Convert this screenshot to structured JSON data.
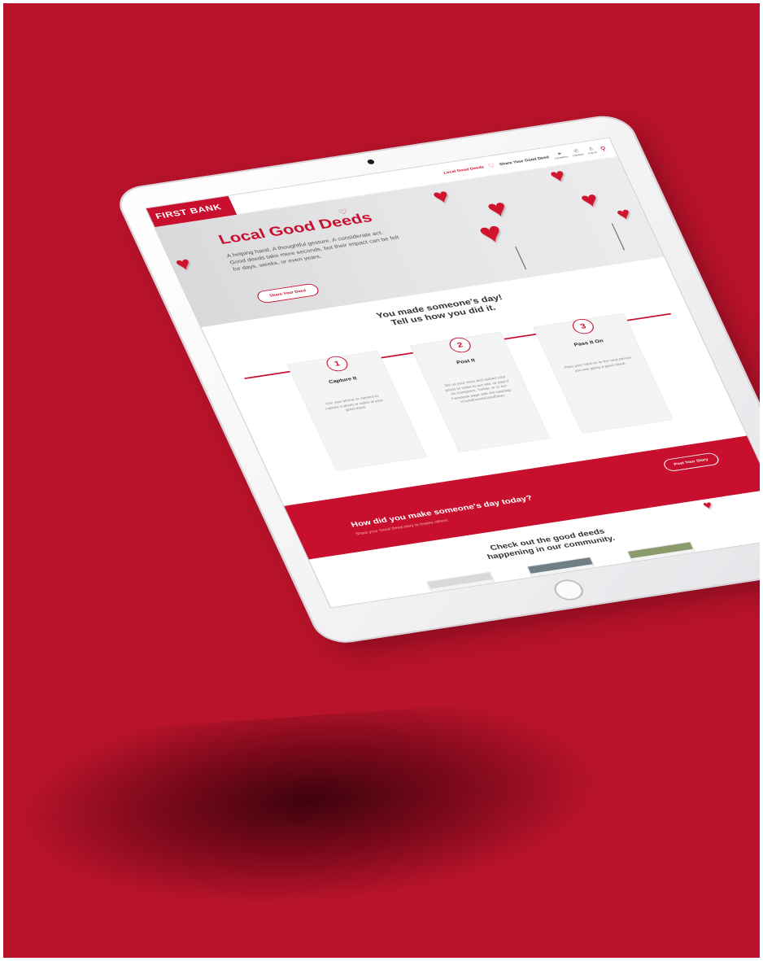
{
  "header": {
    "brand": "FIRST BANK",
    "nav": {
      "local_good_deeds": "Local Good Deeds",
      "share_good_deed": "Share Your Good Deed",
      "locations": "Locations",
      "contact": "Contact",
      "login": "Log In"
    }
  },
  "hero": {
    "title": "Local Good Deeds",
    "body": "A helping hand. A thoughtful gesture. A considerate act. Good deeds take mere seconds, but their impact can be felt for days, weeks, or even years.",
    "button": "Share Your Deed"
  },
  "steps": {
    "title_line1": "You made someone's day!",
    "title_line2": "Tell us how you did it.",
    "items": [
      {
        "number": "1",
        "title": "Capture It",
        "desc": "Use your phone or camera to capture a photo or video of your good deed."
      },
      {
        "number": "2",
        "title": "Post It",
        "desc": "Tell us your story and upload your photo or video to our site, or post it on Instagram, Twitter, or to our Facebook page with the hashtag #GoodDeedsGoodDays."
      },
      {
        "number": "3",
        "title": "Pass It On",
        "desc": "Pass your card on to the next person you see going a good deed!"
      }
    ]
  },
  "band": {
    "question": "How did you make someone's day today?",
    "sub": "Share your Good Deed story to inspire others.",
    "button": "Post Your Story"
  },
  "community": {
    "title_line1": "Check out the good deeds",
    "title_line2": "happening in our community."
  },
  "icons": [
    "heart-outline-icon",
    "location-arrow-icon",
    "phone-icon",
    "user-icon",
    "search-icon",
    "paper-heart-icon"
  ],
  "colors": {
    "brand_red": "#c8102e",
    "background_red": "#b8132b",
    "device_white": "#f2f2f4"
  }
}
